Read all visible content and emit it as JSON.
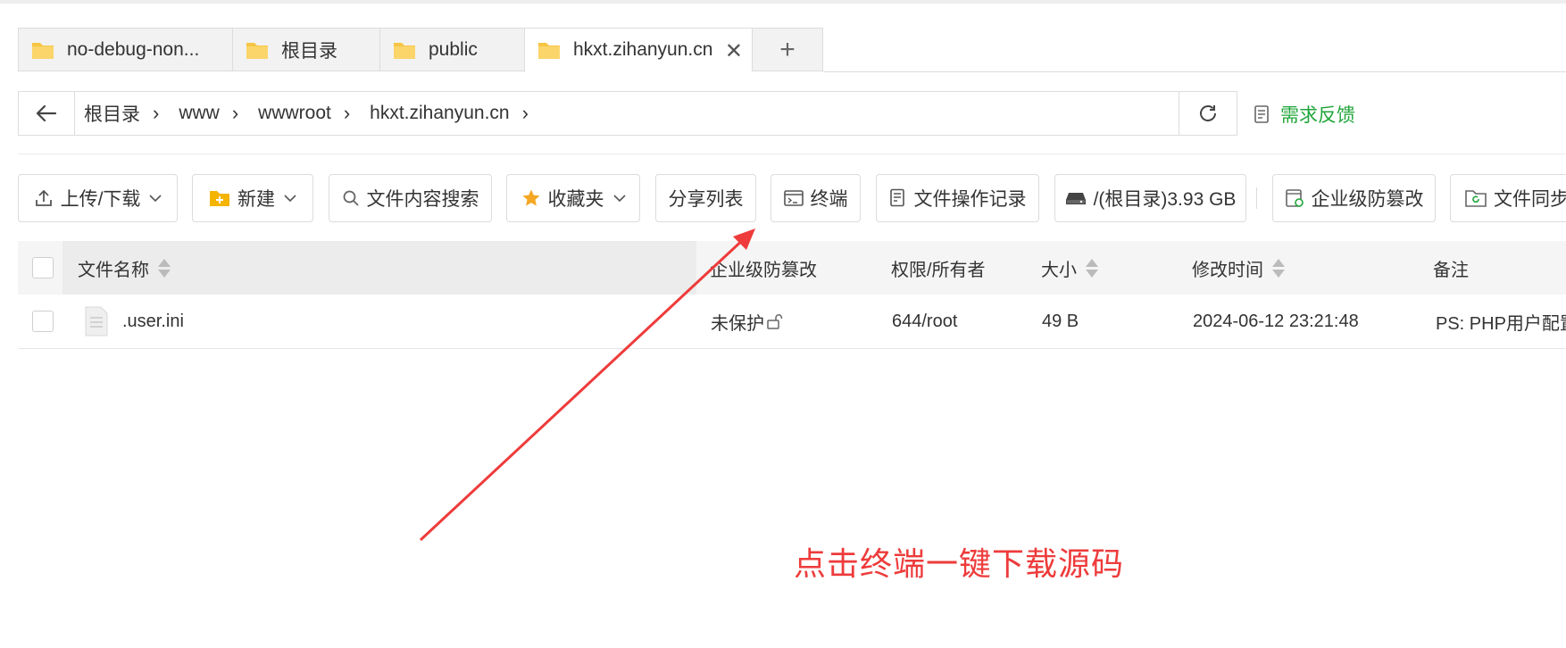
{
  "tabs": [
    {
      "label": "no-debug-non...",
      "active": false
    },
    {
      "label": "根目录",
      "active": false
    },
    {
      "label": "public",
      "active": false
    },
    {
      "label": "hkxt.zihanyun.cn",
      "active": true
    }
  ],
  "tab_add_label": "+",
  "breadcrumb": [
    "根目录",
    "www",
    "wwwroot",
    "hkxt.zihanyun.cn"
  ],
  "feedback_label": "需求反馈",
  "toolbar": {
    "upload_download": "上传/下载",
    "new": "新建",
    "content_search": "文件内容搜索",
    "favorites": "收藏夹",
    "share_list": "分享列表",
    "terminal": "终端",
    "operation_log": "文件操作记录",
    "disk": "/(根目录)3.93 GB",
    "tamper_proof": "企业级防篡改",
    "file_sync": "文件同步"
  },
  "table": {
    "headers": {
      "name": "文件名称",
      "tamper": "企业级防篡改",
      "perm": "权限/所有者",
      "size": "大小",
      "mtime": "修改时间",
      "note": "备注"
    },
    "rows": [
      {
        "name": ".user.ini",
        "tamper": "未保护",
        "perm": "644/root",
        "size": "49 B",
        "mtime": "2024-06-12 23:21:48",
        "note": "PS: PHP用户配置"
      }
    ]
  },
  "annotation": {
    "text": "点击终端一键下载源码",
    "color": "#ee3b3b"
  },
  "colors": {
    "accent_green": "#20a53a",
    "folder_yellow": "#f7c544",
    "border": "#dcdcdc"
  }
}
